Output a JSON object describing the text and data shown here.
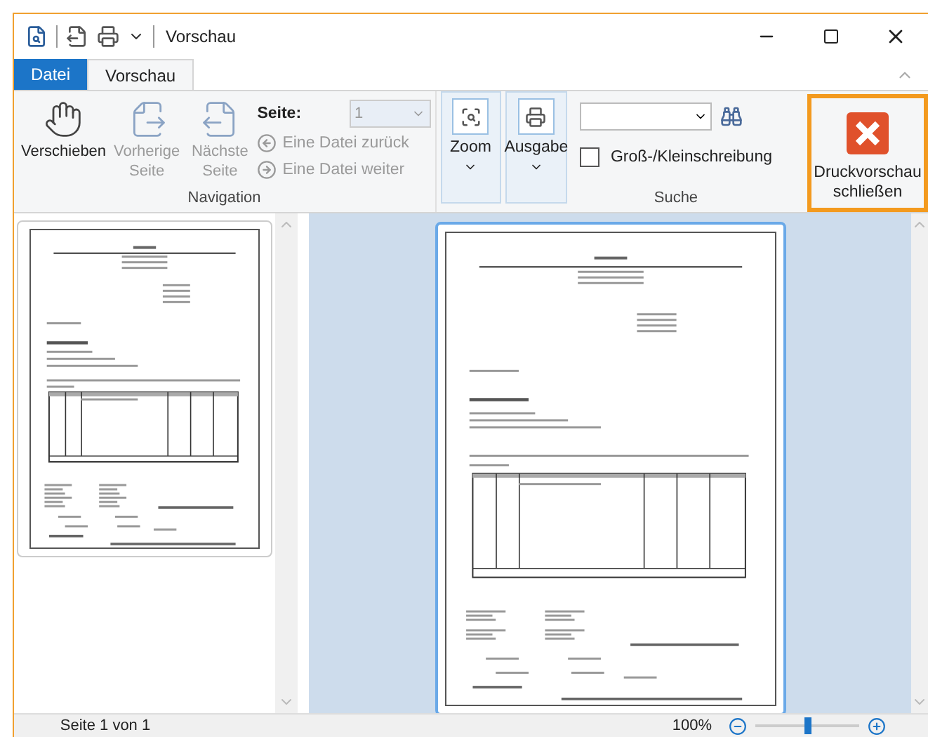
{
  "window": {
    "title": "Vorschau"
  },
  "tabs": [
    {
      "label": "Datei",
      "kind": "file",
      "selected": false
    },
    {
      "label": "Vorschau",
      "kind": "tab",
      "selected": true
    }
  ],
  "navigation": {
    "label": "Navigation",
    "buttons": [
      {
        "label": "Verschieben",
        "kind": "hand",
        "disabled": false
      },
      {
        "label": "Vorherige Seite",
        "kind": "prev",
        "disabled": true
      },
      {
        "label": "Nächste Seite",
        "kind": "next",
        "disabled": true
      }
    ],
    "page_label": "Seite:",
    "page_field": {
      "value": "1",
      "disabled": true
    },
    "links": [
      {
        "label": "Eine Datei zurück",
        "kind": "back",
        "disabled": true
      },
      {
        "label": "Eine Datei weiter",
        "kind": "forward",
        "disabled": true
      }
    ]
  },
  "tools": [
    {
      "label": "Zoom",
      "kind": "zoom"
    },
    {
      "label": "Ausgabe",
      "kind": "print"
    }
  ],
  "search": {
    "label": "Suche",
    "checkbox": {
      "label": "Groß-/Kleinschreibung",
      "checked": false
    }
  },
  "close_preview": {
    "label": "Druckvorschau schließen",
    "highlighted": true
  },
  "status_bar": {
    "page": "Seite 1 von 1",
    "zoom": "100%",
    "level": 0.5
  }
}
